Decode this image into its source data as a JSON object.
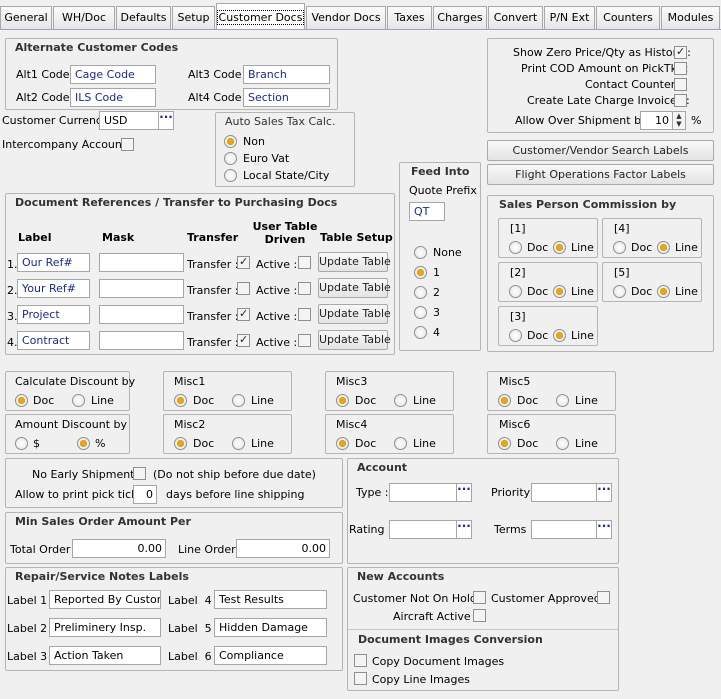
{
  "tabs": [
    "General",
    "WH/Doc",
    "Defaults",
    "Setup",
    "Customer Docs",
    "Vendor Docs",
    "Taxes",
    "Charges",
    "Convert",
    "P/N Ext",
    "Counters",
    "Modules"
  ],
  "alt_codes": {
    "title": "Alternate Customer Codes",
    "alt1_label": "Alt1 Code :",
    "alt1_value": "Cage Code",
    "alt2_label": "Alt2 Code :",
    "alt2_value": "ILS Code",
    "alt3_label": "Alt3 Code :",
    "alt3_value": "Branch",
    "alt4_label": "Alt4 Code :",
    "alt4_value": "Section"
  },
  "currency": {
    "label": "Customer Currency :",
    "value": "USD",
    "dots": "···"
  },
  "intercompany": {
    "label": "Intercompany Account :"
  },
  "auto_tax": {
    "title": "Auto Sales Tax Calc.",
    "options": [
      "Non",
      "Euro Vat",
      "Local State/City"
    ]
  },
  "options_right": {
    "zero_price": "Show Zero Price/Qty as History :",
    "print_cod": "Print COD Amount on PickTkt :",
    "contact_counter": "Contact Counter :",
    "late_charge": "Create Late Charge Invoices :",
    "over_shipment_label": "Allow Over Shipment by :",
    "over_shipment_value": "10",
    "over_shipment_unit": "%"
  },
  "buttons": {
    "search_labels": "Customer/Vendor Search Labels",
    "flight_ops": "Flight Operations Factor Labels"
  },
  "feed_into": {
    "title": "Feed Into",
    "quote_prefix_label": "Quote Prefix",
    "quote_prefix_value": "QT",
    "options": [
      "None",
      "1",
      "2",
      "3",
      "4"
    ]
  },
  "doc_refs": {
    "title": "Document References / Transfer to Purchasing Docs",
    "col_label": "Label",
    "col_mask": "Mask",
    "col_transfer": "Transfer",
    "col_user_table": "User Table\nDriven",
    "col_table_setup": "Table Setup",
    "transfer_label": "Transfer :",
    "active_label": "Active :",
    "update_label": "Update Table",
    "rows": [
      {
        "num": "1.",
        "label": "Our Ref#"
      },
      {
        "num": "2.",
        "label": "Your Ref#"
      },
      {
        "num": "3.",
        "label": "Project"
      },
      {
        "num": "4.",
        "label": "Contract"
      }
    ]
  },
  "commission": {
    "title": "Sales Person Commission by",
    "doc": "Doc",
    "line": "Line",
    "groups": [
      "[1]",
      "[4]",
      "[2]",
      "[5]",
      "[3]"
    ]
  },
  "misc": {
    "calc_discount": "Calculate Discount by",
    "amount_discount": "Amount Discount by",
    "doc": "Doc",
    "line": "Line",
    "dollar": "$",
    "percent": "%",
    "misc1": "Misc1",
    "misc2": "Misc2",
    "misc3": "Misc3",
    "misc4": "Misc4",
    "misc5": "Misc5",
    "misc6": "Misc6"
  },
  "shipping": {
    "no_early": "No Early Shipments",
    "no_early_note": "(Do not ship before due date)",
    "allow_print": "Allow to print pick ticket",
    "days_value": "0",
    "days_note": "days before line shipping"
  },
  "min_sales": {
    "title": "Min Sales Order Amount Per",
    "total_label": "Total Order :",
    "total_value": "0.00",
    "line_label": "Line Order :",
    "line_value": "0.00"
  },
  "repair": {
    "title": "Repair/Service Notes Labels",
    "l1": "Label 1 :",
    "v1": "Reported By Customer",
    "l2": "Label 2 :",
    "v2": "Preliminery Insp.",
    "l3": "Label 3 :",
    "v3": "Action Taken",
    "l4": "Label  4 :",
    "v4": "Test Results",
    "l5": "Label  5 :",
    "v5": "Hidden Damage",
    "l6": "Label  6 :",
    "v6": "Compliance"
  },
  "account": {
    "title": "Account",
    "type": "Type :",
    "priority": "Priority :",
    "rating": "Rating :",
    "terms": "Terms :"
  },
  "new_accounts": {
    "title": "New Accounts",
    "not_on_hold": "Customer Not On Hold :",
    "approved": "Customer Approved :",
    "aircraft": "Aircraft Active :"
  },
  "doc_images": {
    "title": "Document Images Conversion",
    "copy_doc": "Copy Document Images",
    "copy_line": "Copy Line Images"
  }
}
